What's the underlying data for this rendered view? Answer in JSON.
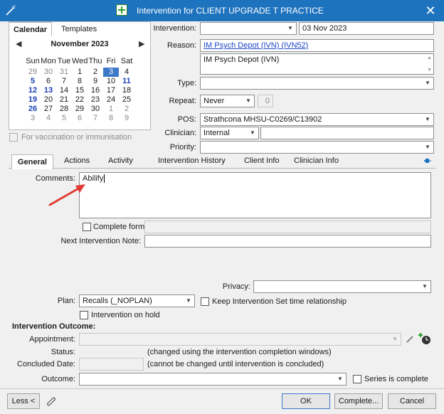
{
  "window": {
    "title": "Intervention for CLIENT UPGRADE T PRACTICE",
    "close": "✕"
  },
  "calendar": {
    "tabs": [
      "Calendar",
      "Templates"
    ],
    "month": "November 2023",
    "prev": "◀",
    "next": "▶",
    "weekdays": [
      "Sun",
      "Mon",
      "Tue",
      "Wed",
      "Thu",
      "Fri",
      "Sat"
    ],
    "weeks": [
      [
        "29",
        "30",
        "31",
        "1",
        "2",
        "3",
        "4"
      ],
      [
        "5",
        "6",
        "7",
        "8",
        "9",
        "10",
        "11"
      ],
      [
        "12",
        "13",
        "14",
        "15",
        "16",
        "17",
        "18"
      ],
      [
        "19",
        "20",
        "21",
        "22",
        "23",
        "24",
        "25"
      ],
      [
        "26",
        "27",
        "28",
        "29",
        "30",
        "1",
        "2"
      ],
      [
        "3",
        "4",
        "5",
        "6",
        "7",
        "8",
        "9"
      ]
    ],
    "vaccination_label": "For vaccination or immunisation"
  },
  "form": {
    "intervention_label": "Intervention:",
    "intervention_value": "",
    "date_value": "03 Nov 2023",
    "reason_label": "Reason:",
    "reason_link": "IM Psych Depot (IVN) (IVN52)",
    "reason_text": "IM Psych Depot (IVN)",
    "type_label": "Type:",
    "type_value": "",
    "repeat_label": "Repeat:",
    "repeat_value": "Never",
    "repeat_count": "0",
    "pos_label": "POS:",
    "pos_value": "Strathcona MHSU-C0269/C13902",
    "clinician_label": "Clinician:",
    "clinician_value": "Internal",
    "clinician_name": "",
    "priority_label": "Priority:",
    "priority_value": ""
  },
  "tabs": [
    "General",
    "Actions",
    "Activity",
    "Intervention History",
    "Client Info",
    "Clinician Info"
  ],
  "general": {
    "comments_label": "Comments:",
    "comments_value": "Abilify",
    "complete_form_label": "Complete form:",
    "next_note_label": "Next Intervention Note:",
    "privacy_label": "Privacy:",
    "plan_label": "Plan:",
    "plan_value": "Recalls (_NOPLAN)",
    "keep_label": "Keep Intervention Set time relationship",
    "on_hold_label": "Intervention on hold"
  },
  "outcome": {
    "section_title": "Intervention Outcome:",
    "appointment_label": "Appointment:",
    "status_label": "Status:",
    "status_note": "(changed using the intervention completion windows)",
    "concluded_label": "Concluded Date:",
    "concluded_note": "(cannot be changed until intervention is concluded)",
    "outcome_label": "Outcome:",
    "series_label": "Series is complete"
  },
  "buttons": {
    "less": "Less <",
    "ok": "OK",
    "complete": "Complete...",
    "cancel": "Cancel"
  },
  "colors": {
    "titlebar": "#1e73be",
    "accent": "#3c78c8",
    "annotation_arrow": "#e03c31"
  }
}
